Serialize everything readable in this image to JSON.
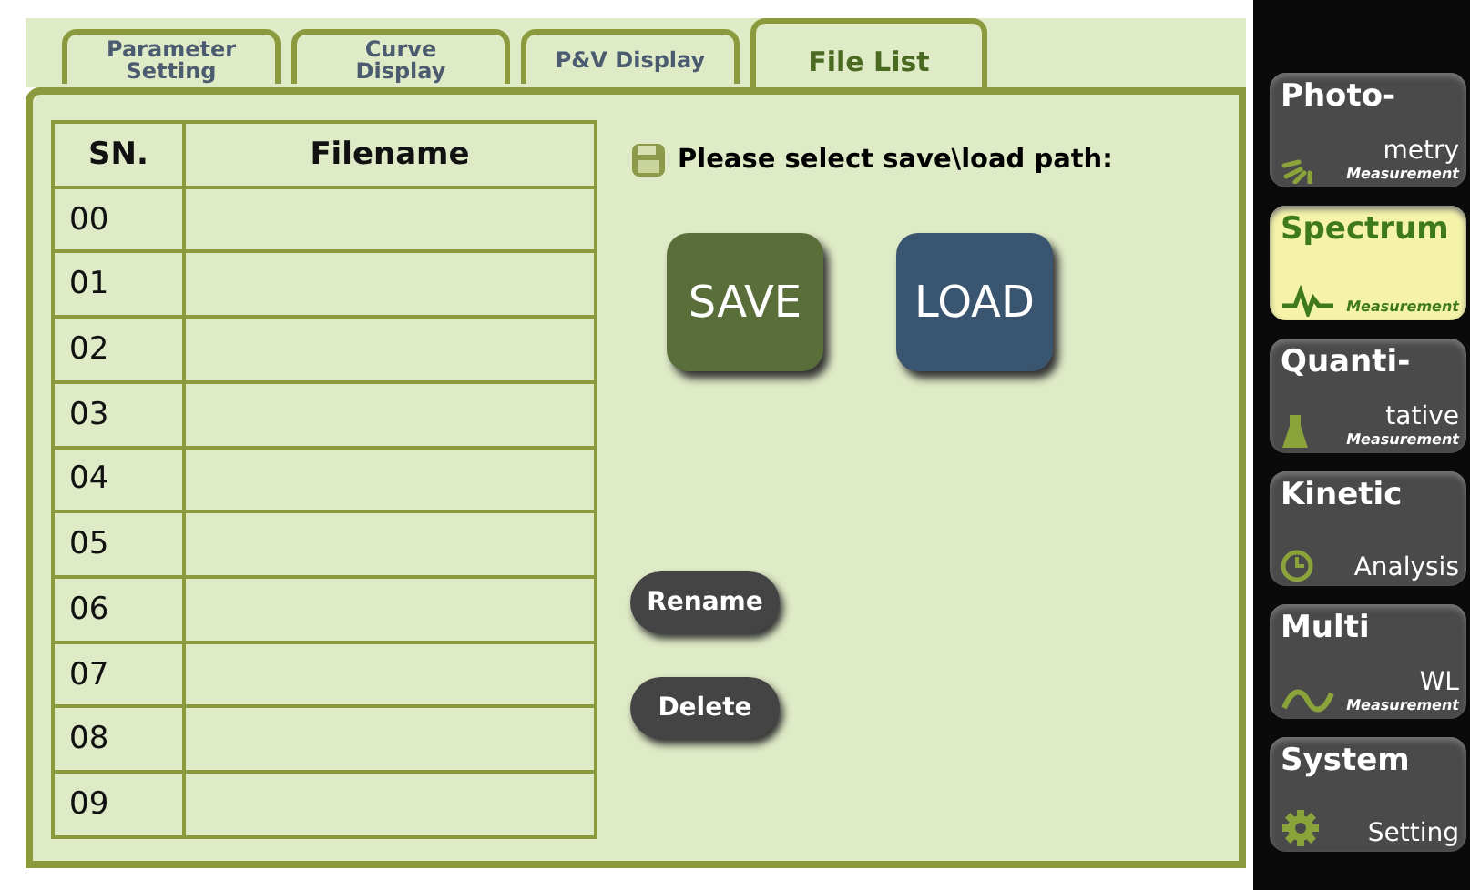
{
  "tabs": [
    {
      "label": "Parameter\nSetting",
      "selected": false
    },
    {
      "label": "Curve\nDisplay",
      "selected": false
    },
    {
      "label": "P&V Display",
      "selected": false
    },
    {
      "label": "File List",
      "selected": true
    }
  ],
  "table": {
    "columns": [
      "SN.",
      "Filename"
    ],
    "rows": [
      {
        "sn": "00"
      },
      {
        "sn": "01"
      },
      {
        "sn": "02"
      },
      {
        "sn": "03"
      },
      {
        "sn": "04"
      },
      {
        "sn": "05"
      },
      {
        "sn": "06"
      },
      {
        "sn": "07"
      },
      {
        "sn": "08"
      },
      {
        "sn": "09"
      }
    ]
  },
  "path_prompt": "Please select save\\load path:",
  "big_buttons": [
    {
      "label": "SAVE",
      "kind": "save"
    },
    {
      "label": "LOAD",
      "kind": "load"
    }
  ],
  "small_buttons": [
    "Rename",
    "Delete"
  ],
  "sidebar": {
    "items": [
      {
        "title": "Photo-",
        "line2": "metry",
        "sub": "Measurement",
        "kind": "rays",
        "selected": false
      },
      {
        "title": "Spectrum",
        "sub": "Measurement",
        "kind": "pulse",
        "selected": true
      },
      {
        "title": "Quanti-",
        "line2": "tative",
        "sub": "Measurement",
        "kind": "flask",
        "selected": false
      },
      {
        "title": "Kinetic",
        "line2": "Analysis",
        "kind": "clock",
        "selected": false
      },
      {
        "title": "Multi",
        "line2": "WL",
        "sub": "Measurement",
        "kind": "wave",
        "selected": false
      },
      {
        "title": "System",
        "line2": "Setting",
        "kind": "gear",
        "selected": false
      }
    ]
  }
}
